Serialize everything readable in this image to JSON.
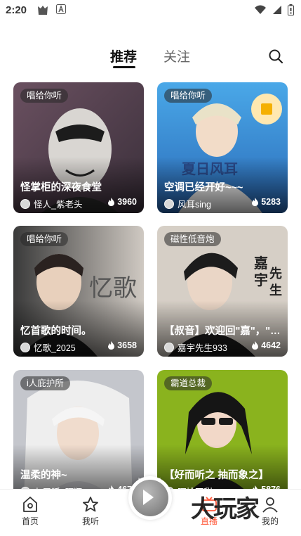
{
  "status_bar": {
    "time": "2:20"
  },
  "top_tabs": {
    "recommend": "推荐",
    "follow": "关注"
  },
  "cards": [
    {
      "tag": "唱给你听",
      "title": "怪掌柜的深夜食堂",
      "host": "怪人_紫老头",
      "heat": "3960"
    },
    {
      "tag": "唱给你听",
      "title": "空调已经开好~~~",
      "host": "风耳sing",
      "heat": "5283"
    },
    {
      "tag": "唱给你听",
      "title": "忆首歌的时间。",
      "host": "忆歌_2025",
      "heat": "3658"
    },
    {
      "tag": "磁性低音炮",
      "title": "【叔音】欢迎回\"嘉\"，\"…",
      "host": "嘉宇先生933",
      "heat": "4642"
    },
    {
      "tag": "i人庇护所",
      "title": "温柔的神~",
      "host": "九尾狐_阿狸",
      "heat": "4674"
    },
    {
      "tag": "霸道总裁",
      "title": "【好而听之 抽而象之】",
      "host": "阿桃不甜_Man",
      "heat": "5876"
    }
  ],
  "bottom_nav": {
    "home": "首页",
    "listen": "我听",
    "live": "直播",
    "me": "我的"
  },
  "watermark": "大玩家",
  "colors": {
    "accent": "#ff5a3c",
    "active_tab": "#111111",
    "inactive_tab": "#666666"
  }
}
